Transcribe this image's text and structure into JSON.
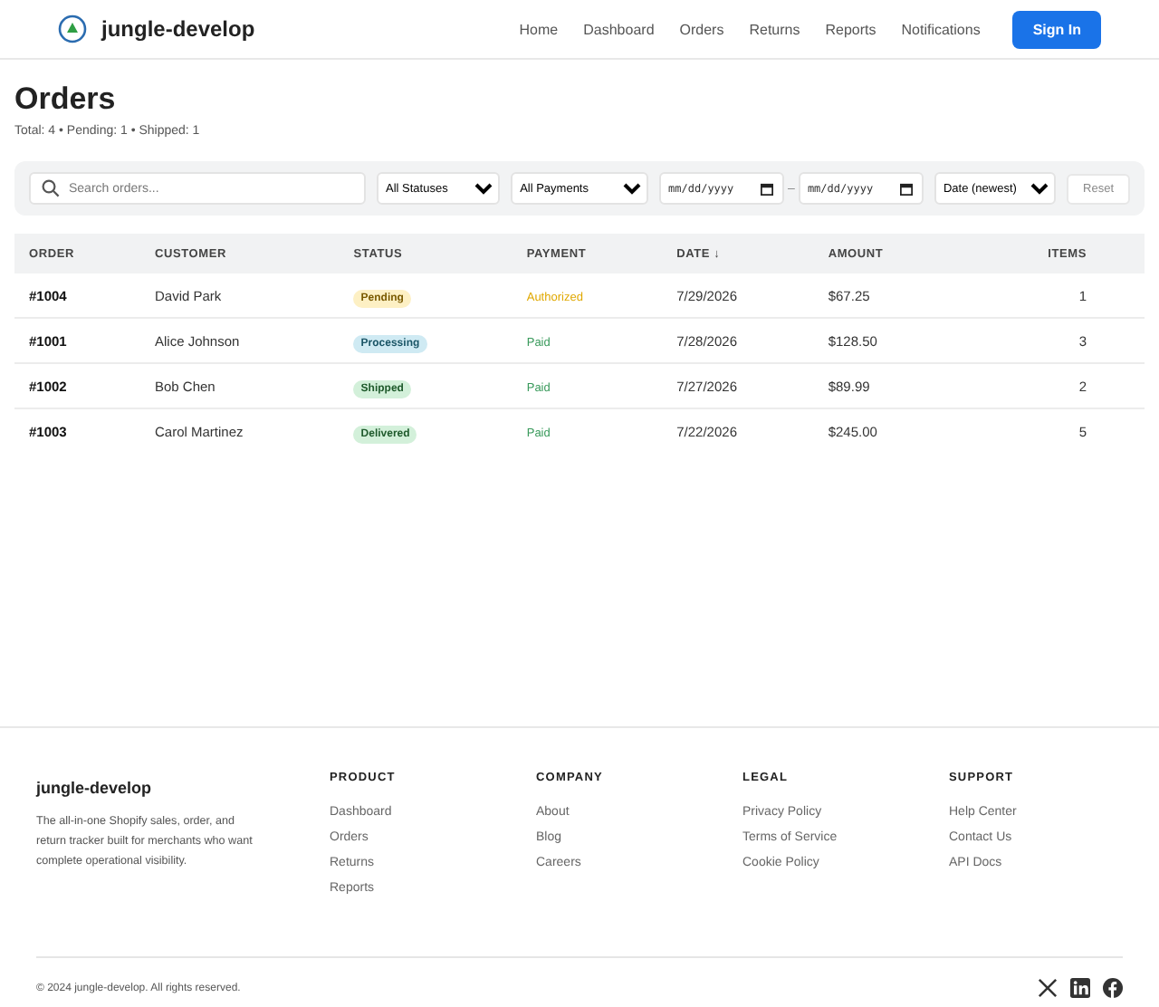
{
  "header": {
    "brand": "jungle-develop",
    "nav": [
      {
        "label": "Home"
      },
      {
        "label": "Dashboard"
      },
      {
        "label": "Orders"
      },
      {
        "label": "Returns"
      },
      {
        "label": "Reports"
      },
      {
        "label": "Notifications"
      }
    ],
    "sign_in": "Sign In"
  },
  "page": {
    "title": "Orders",
    "summary": "Total: 4 • Pending: 1 • Shipped: 1"
  },
  "filters": {
    "search_placeholder": "Search orders...",
    "status": "All Statuses",
    "payment": "All Payments",
    "date_from": {
      "placeholder": "mm/dd/yyyy"
    },
    "separator": "–",
    "date_to": {
      "placeholder": "mm/dd/yyyy"
    },
    "sort": "Date (newest)",
    "reset": "Reset"
  },
  "table": {
    "columns": [
      "ORDER",
      "CUSTOMER",
      "STATUS",
      "PAYMENT",
      "DATE ↓",
      "AMOUNT",
      "ITEMS"
    ],
    "rows": [
      {
        "order": "#1004",
        "customer": "David Park",
        "status": {
          "label": "Pending",
          "kind": "pending"
        },
        "payment": {
          "label": "Authorized",
          "kind": "authorized"
        },
        "date": "7/29/2026",
        "amount": "$67.25",
        "items": "1"
      },
      {
        "order": "#1001",
        "customer": "Alice Johnson",
        "status": {
          "label": "Processing",
          "kind": "processing"
        },
        "payment": {
          "label": "Paid",
          "kind": "paid"
        },
        "date": "7/28/2026",
        "amount": "$128.50",
        "items": "3"
      },
      {
        "order": "#1002",
        "customer": "Bob Chen",
        "status": {
          "label": "Shipped",
          "kind": "shipped"
        },
        "payment": {
          "label": "Paid",
          "kind": "paid"
        },
        "date": "7/27/2026",
        "amount": "$89.99",
        "items": "2"
      },
      {
        "order": "#1003",
        "customer": "Carol Martinez",
        "status": {
          "label": "Delivered",
          "kind": "delivered"
        },
        "payment": {
          "label": "Paid",
          "kind": "paid"
        },
        "date": "7/22/2026",
        "amount": "$245.00",
        "items": "5"
      }
    ]
  },
  "footer": {
    "brand": "jungle-develop",
    "description": "The all-in-one Shopify sales, order, and return tracker built for merchants who want complete operational visibility.",
    "columns": [
      {
        "heading": "PRODUCT",
        "links": [
          "Dashboard",
          "Orders",
          "Returns",
          "Reports"
        ]
      },
      {
        "heading": "COMPANY",
        "links": [
          "About",
          "Blog",
          "Careers"
        ]
      },
      {
        "heading": "LEGAL",
        "links": [
          "Privacy Policy",
          "Terms of Service",
          "Cookie Policy"
        ]
      },
      {
        "heading": "SUPPORT",
        "links": [
          "Help Center",
          "Contact Us",
          "API Docs"
        ]
      }
    ],
    "copyright": "© 2024 jungle-develop. All rights reserved."
  }
}
